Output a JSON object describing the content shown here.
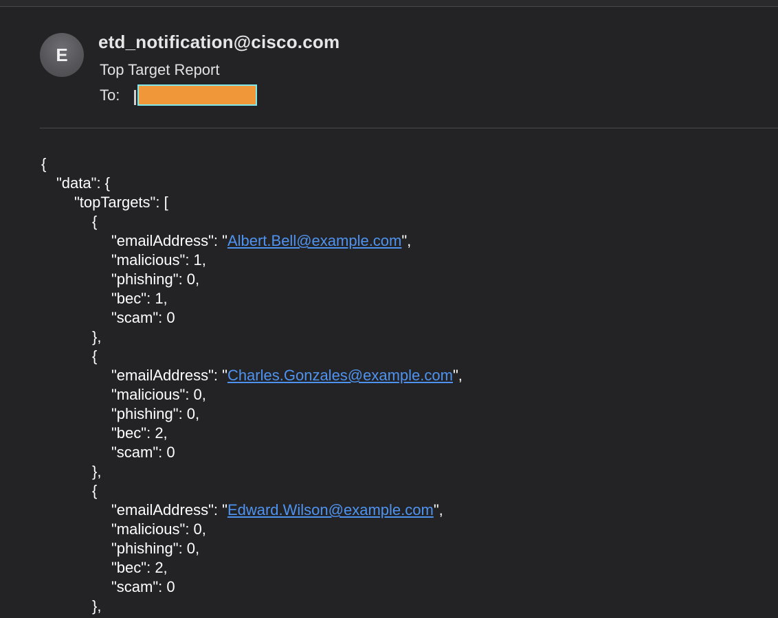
{
  "email": {
    "avatar_initial": "E",
    "sender": "etd_notification@cisco.com",
    "subject": "Top Target Report",
    "to_label": "To:"
  },
  "json_lines": {
    "l1": "{",
    "l2": "\"data\": {",
    "l3": "\"topTargets\": [",
    "l4": "{",
    "e1": {
      "prefix": "\"emailAddress\": \"",
      "address": "Albert.Bell@example.com",
      "suffix": "\",",
      "malicious": "\"malicious\": 1,",
      "phishing": "\"phishing\": 0,",
      "bec": "\"bec\": 1,",
      "scam": "\"scam\": 0",
      "close": "},"
    },
    "e2": {
      "open": "{",
      "prefix": "\"emailAddress\": \"",
      "address": "Charles.Gonzales@example.com",
      "suffix": "\",",
      "malicious": "\"malicious\": 0,",
      "phishing": "\"phishing\": 0,",
      "bec": "\"bec\": 2,",
      "scam": "\"scam\": 0",
      "close": "},"
    },
    "e3": {
      "open": "{",
      "prefix": "\"emailAddress\": \"",
      "address": "Edward.Wilson@example.com",
      "suffix": "\",",
      "malicious": "\"malicious\": 0,",
      "phishing": "\"phishing\": 0,",
      "bec": "\"bec\": 2,",
      "scam": "\"scam\": 0",
      "close": "},"
    }
  },
  "colors": {
    "background": "#232325",
    "link": "#4f93f0",
    "redaction_fill": "#f0973a",
    "redaction_border": "#7fe8ee"
  }
}
